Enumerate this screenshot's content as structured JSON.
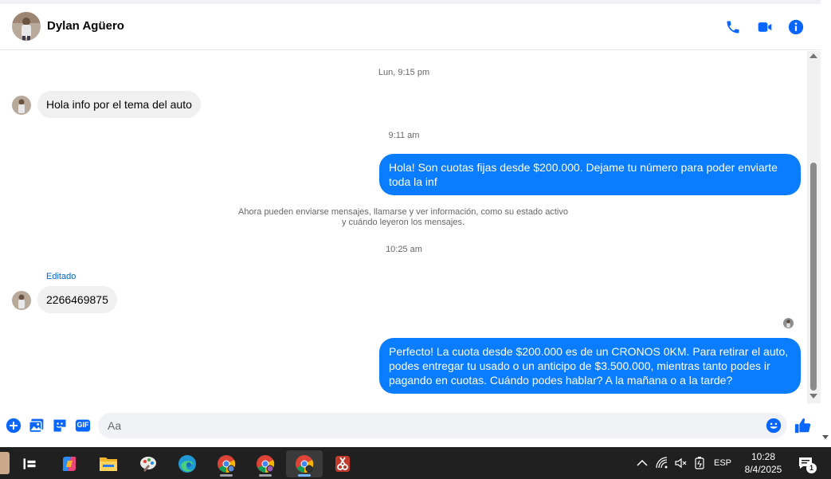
{
  "contact": {
    "name": "Dylan Agüero"
  },
  "header_icons": [
    "phone-icon",
    "video-camera-icon",
    "info-icon"
  ],
  "messages": {
    "ts1": "Lun, 9:15 pm",
    "in1": "Hola info por el tema del auto",
    "ts2": "9:11 am",
    "out1": "Hola! Son cuotas fijas desde $200.000. Dejame tu número para poder enviarte toda la inf",
    "system_line1": "Ahora pueden enviarse mensajes, llamarse y ver información, como su estado activo",
    "system_line2": "y cuándo leyeron los mensajes.",
    "ts3": "10:25 am",
    "edited": "Editado",
    "in2": "2266469875",
    "out2": "Perfecto! La cuota desde $200.000 es de un CRONOS 0KM. Para retirar el auto, podes entregar tu usado o un anticipo de $3.500.000, mientras tanto podes ir pagando en cuotas. Cuándo podes hablar? A la mañana o a la tarde?"
  },
  "composer": {
    "placeholder": "Aa",
    "gif_label": "GIF"
  },
  "colors": {
    "accent": "#0a7cff",
    "icon_blue": "#0866ff",
    "incoming_bg": "#f0f0f0"
  },
  "taskbar": {
    "language": "ESP",
    "time": "10:28",
    "date": "8/4/2025",
    "notification_count": "1"
  }
}
